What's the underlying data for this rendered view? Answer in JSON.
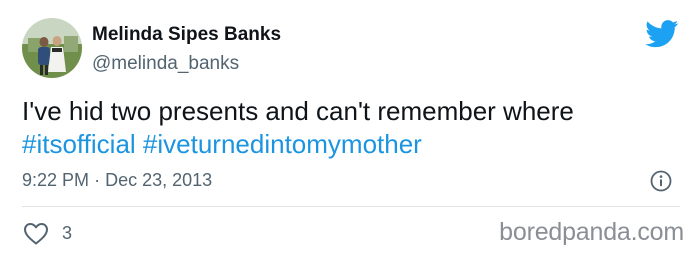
{
  "author": {
    "name": "Melinda Sipes Banks",
    "handle": "@melinda_banks"
  },
  "tweet": {
    "text": "I've hid two presents and can't remember where",
    "hashtags": [
      "#itsofficial",
      "#iveturnedintomymother"
    ]
  },
  "meta": {
    "time": "9:22 PM",
    "separator": "·",
    "date": "Dec 23, 2013"
  },
  "actions": {
    "like_count": "3"
  },
  "watermark": "boredpanda.com",
  "icons": {
    "brand": "twitter-bird-icon",
    "info": "info-icon",
    "like": "heart-icon"
  },
  "colors": {
    "link": "#1b95e0",
    "secondary_text": "#536471",
    "twitter_blue": "#1da1f2",
    "divider": "#dfe3e6"
  }
}
